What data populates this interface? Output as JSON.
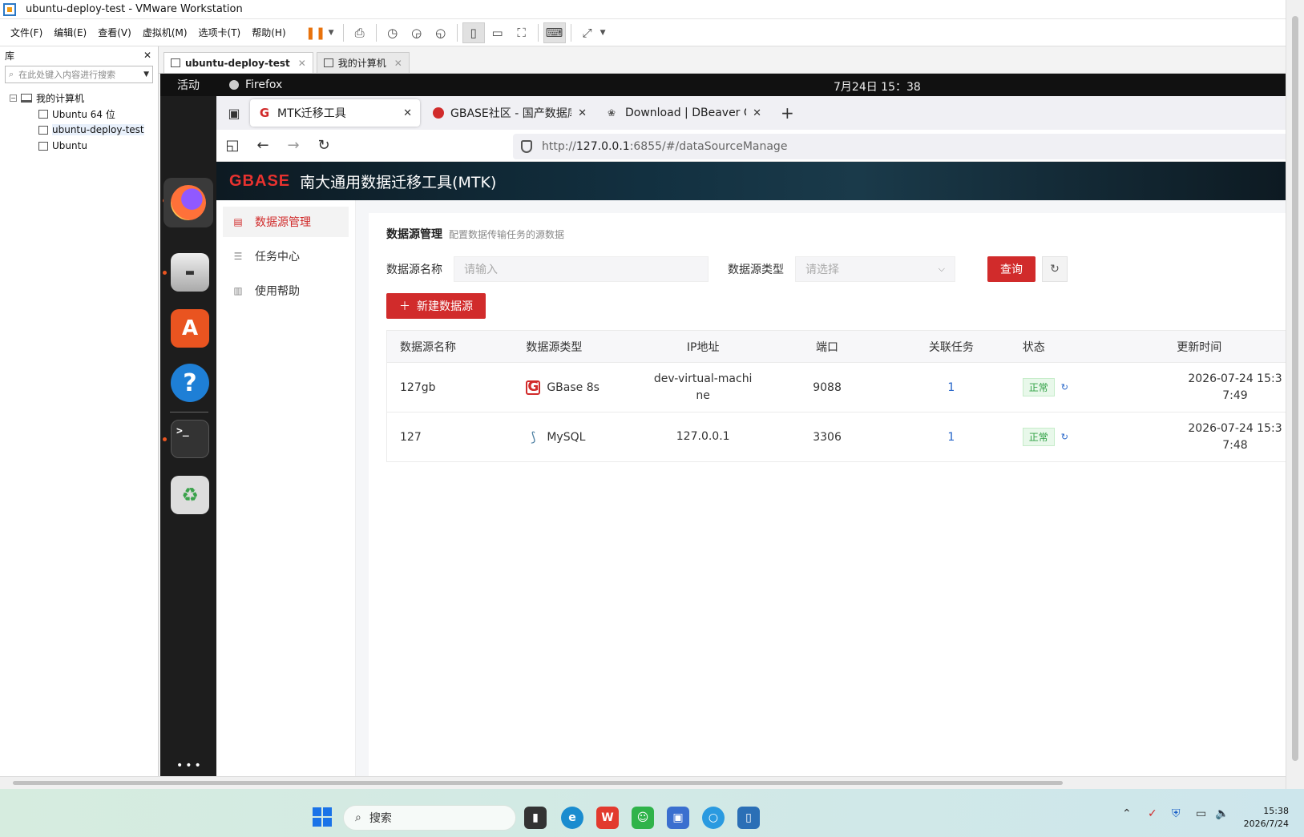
{
  "vmware": {
    "title": "ubuntu-deploy-test - VMware Workstation",
    "menu": [
      "文件(F)",
      "编辑(E)",
      "查看(V)",
      "虚拟机(M)",
      "选项卡(T)",
      "帮助(H)"
    ],
    "library": {
      "title": "库",
      "search_placeholder": "在此处键入内容进行搜索",
      "root": "我的计算机",
      "vms": [
        "Ubuntu 64 位",
        "ubuntu-deploy-test",
        "Ubuntu"
      ]
    },
    "tabs": [
      {
        "label": "ubuntu-deploy-test",
        "active": true
      },
      {
        "label": "我的计算机",
        "active": false
      }
    ]
  },
  "gnome": {
    "activities": "活动",
    "app_name": "Firefox",
    "clock": "7月24日 15：38"
  },
  "firefox": {
    "tabs": [
      {
        "title": "MTK迁移工具",
        "active": true
      },
      {
        "title": "GBASE社区 - 国产数据库排",
        "active": false
      },
      {
        "title": "Download | DBeaver Com",
        "active": false
      }
    ],
    "url_prefix": "http://",
    "url_host": "127.0.0.1",
    "url_rest": ":6855/#/dataSourceManage"
  },
  "mtk": {
    "logo": "GBASE",
    "app_title": "南大通用数据迁移工具(MTK)",
    "sidebar": [
      {
        "label": "数据源管理",
        "icon": "list-icon",
        "active": true
      },
      {
        "label": "任务中心",
        "icon": "tasks-icon",
        "active": false
      },
      {
        "label": "使用帮助",
        "icon": "book-icon",
        "active": false
      }
    ],
    "page_title": "数据源管理",
    "page_subtitle": "配置数据传输任务的源数据",
    "filter_name_label": "数据源名称",
    "filter_name_placeholder": "请输入",
    "filter_type_label": "数据源类型",
    "filter_type_placeholder": "请选择",
    "query_button": "查询",
    "new_button": "新建数据源",
    "table": {
      "headers": [
        "数据源名称",
        "数据源类型",
        "IP地址",
        "端口",
        "关联任务",
        "状态",
        "更新时间"
      ],
      "rows": [
        {
          "name": "127gb",
          "type": "GBase 8s",
          "ip": "dev-virtual-machine",
          "port": "9088",
          "tasks": "1",
          "status": "正常",
          "updated": "2026-07-24 15:37:49"
        },
        {
          "name": "127",
          "type": "MySQL",
          "ip": "127.0.0.1",
          "port": "3306",
          "tasks": "1",
          "status": "正常",
          "updated": "2026-07-24 15:37:48"
        }
      ]
    },
    "accent_color": "#d12b2b"
  },
  "taskbar": {
    "search_label": "搜索",
    "time": "15:38",
    "date": "2026/7/24"
  }
}
